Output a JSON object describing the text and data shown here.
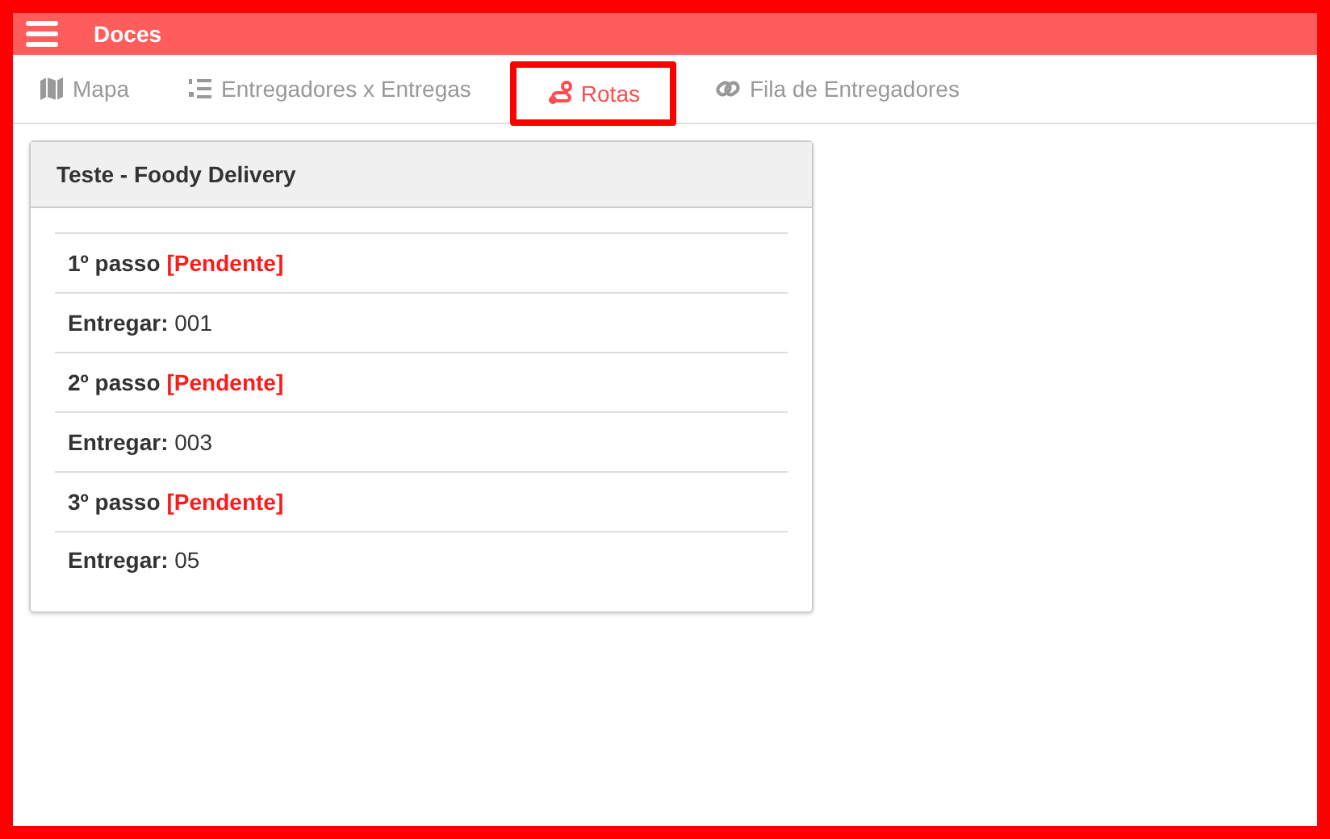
{
  "app_bar": {
    "title": "Doces"
  },
  "tabs": [
    {
      "label": "Mapa",
      "kind": "map",
      "selected": false,
      "highlighted": false
    },
    {
      "label": "Entregadores x Entregas",
      "kind": "list",
      "selected": false,
      "highlighted": false
    },
    {
      "label": "Rotas",
      "kind": "route",
      "selected": true,
      "highlighted": true
    },
    {
      "label": "Fila de Entregadores",
      "kind": "link",
      "selected": false,
      "highlighted": false
    }
  ],
  "card": {
    "title": "Teste - Foody Delivery",
    "rows": [
      {
        "kind": "step",
        "label": "1º passo",
        "status": "[Pendente]"
      },
      {
        "kind": "delivery",
        "text": "**Entregar:** 001"
      },
      {
        "kind": "step",
        "label": "2º passo",
        "status": "[Pendente]"
      },
      {
        "kind": "delivery",
        "text": "**Entregar:** 003"
      },
      {
        "kind": "step",
        "label": "3º passo",
        "status": "[Pendente]"
      },
      {
        "kind": "delivery",
        "text": "**Entregar:** 05"
      }
    ]
  }
}
